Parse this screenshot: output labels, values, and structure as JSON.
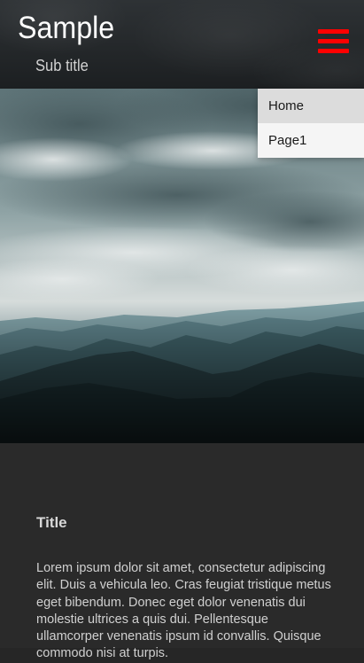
{
  "header": {
    "title": "Sample",
    "subtitle": "Sub title",
    "menu_icon": "hamburger-menu-icon",
    "menu_icon_color": "#ff0000"
  },
  "nav": {
    "items": [
      {
        "label": "Home",
        "active": true
      },
      {
        "label": "Page1",
        "active": false
      }
    ]
  },
  "hero": {
    "image": "cloudy sky over mountain range"
  },
  "content": {
    "title": "Title",
    "body": "Lorem ipsum dolor sit amet, consectetur adipiscing elit. Duis a vehicula leo. Cras feugiat tristique metus eget bibendum. Donec eget dolor venenatis dui molestie ultrices a quis dui. Pellentesque ullamcorper venenatis ipsum id convallis. Quisque commodo nisi at turpis."
  }
}
